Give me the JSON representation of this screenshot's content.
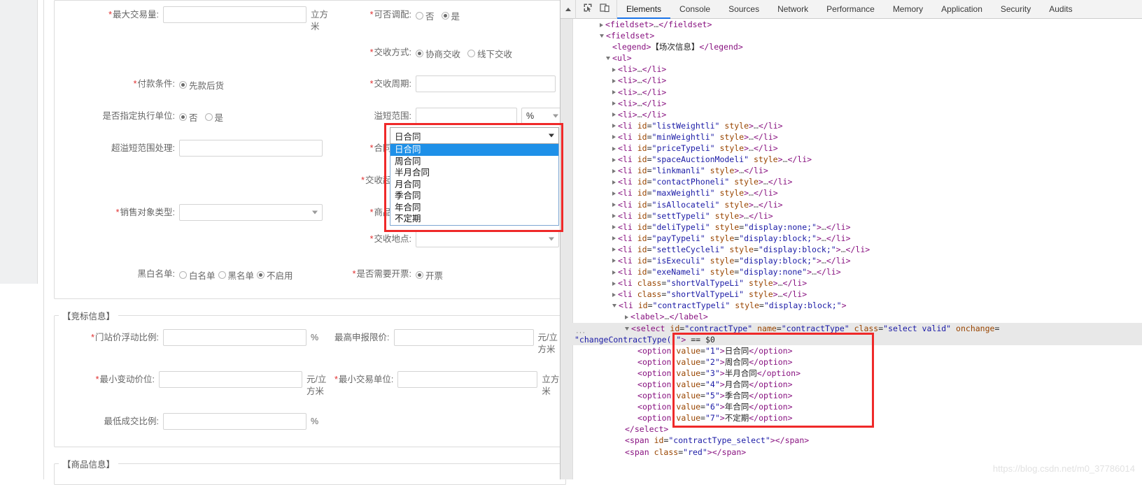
{
  "browser": {
    "section_auction": {
      "rows_left": [
        {
          "label": "最大交易量",
          "required": true,
          "type": "input",
          "value": "",
          "unit": "立方米"
        },
        {
          "label": "付款条件",
          "required": true,
          "type": "radio",
          "options": [
            {
              "text": "先款后货",
              "checked": true
            }
          ]
        },
        {
          "label": "是否指定执行单位",
          "required": false,
          "type": "radio",
          "options": [
            {
              "text": "否",
              "checked": true
            },
            {
              "text": "是",
              "checked": false
            }
          ]
        },
        {
          "label": "超溢短范围处理",
          "required": false,
          "type": "input",
          "value": "",
          "unit": ""
        },
        {
          "label": "销售对象类型",
          "required": true,
          "type": "select",
          "value": ""
        },
        {
          "label": "黑白名单",
          "required": false,
          "type": "radio",
          "options": [
            {
              "text": "白名单",
              "checked": false
            },
            {
              "text": "黑名单",
              "checked": false
            },
            {
              "text": "不启用",
              "checked": true
            }
          ]
        }
      ],
      "rows_right": [
        {
          "label": "可否调配",
          "required": true,
          "type": "radio",
          "options": [
            {
              "text": "否",
              "checked": false
            },
            {
              "text": "是",
              "checked": true
            }
          ]
        },
        {
          "label": "交收方式",
          "required": true,
          "type": "radio",
          "options": [
            {
              "text": "协商交收",
              "checked": true
            },
            {
              "text": "线下交收",
              "checked": false
            }
          ]
        },
        {
          "label": "交收周期",
          "required": true,
          "type": "input",
          "value": "",
          "unit": ""
        },
        {
          "label": "溢短范围",
          "required": false,
          "type": "input_select",
          "value": "",
          "select_value": "%"
        },
        {
          "label": "合同类型",
          "required": true,
          "type": "select_open",
          "value": "日合同"
        },
        {
          "label": "交收起始日",
          "required": true,
          "type": "input",
          "value": "",
          "unit": ""
        },
        {
          "label": "商品运输",
          "required": true,
          "type": "input",
          "value": "",
          "unit": ""
        },
        {
          "label": "交收地点",
          "required": true,
          "type": "select",
          "value": ""
        },
        {
          "label": "是否需要开票",
          "required": true,
          "type": "radio",
          "options": [
            {
              "text": "开票",
              "checked": true
            }
          ]
        }
      ]
    },
    "section_bid": {
      "legend": "【竞标信息】",
      "rows": [
        {
          "label": "门站价浮动比例",
          "required": true,
          "unit": "%",
          "label2": "最高申报限价",
          "required2": false,
          "unit2": "元/立方米"
        },
        {
          "label": "最小变动价位",
          "required": true,
          "unit": "元/立方米",
          "label2": "最小交易单位",
          "required2": true,
          "unit2": "立方米"
        },
        {
          "label": "最低成交比例",
          "required": false,
          "unit": "%",
          "label2": "",
          "required2": false,
          "unit2": ""
        }
      ]
    },
    "section_goods": {
      "legend": "【商品信息】"
    },
    "dropdown": {
      "selected": "日合同",
      "options": [
        "日合同",
        "周合同",
        "半月合同",
        "月合同",
        "季合同",
        "年合同",
        "不定期"
      ],
      "highlight_color": "#ef2929",
      "selected_bg": "#1e90e8"
    }
  },
  "devtools": {
    "toolbar": {
      "inspect_icon": "inspect-element-icon",
      "device_icon": "toggle-device-toolbar-icon",
      "scroll_up_icon": "scroll-up-arrow-icon"
    },
    "tabs": [
      {
        "label": "Elements",
        "active": true
      },
      {
        "label": "Console",
        "active": false
      },
      {
        "label": "Sources",
        "active": false
      },
      {
        "label": "Network",
        "active": false
      },
      {
        "label": "Performance",
        "active": false
      },
      {
        "label": "Memory",
        "active": false
      },
      {
        "label": "Application",
        "active": false
      },
      {
        "label": "Security",
        "active": false
      },
      {
        "label": "Audits",
        "active": false
      }
    ],
    "tree": [
      {
        "indent": 4,
        "tw": "closed",
        "html": "<span class=\"punc\">&lt;</span><span class=\"tag\">fieldset</span><span class=\"punc\">&gt;</span><span class=\"ell\">…</span><span class=\"punc\">&lt;/</span><span class=\"tag\">fieldset</span><span class=\"punc\">&gt;</span>"
      },
      {
        "indent": 4,
        "tw": "open",
        "html": "<span class=\"punc\">&lt;</span><span class=\"tag\">fieldset</span><span class=\"punc\">&gt;</span>"
      },
      {
        "indent": 6,
        "tw": "none",
        "html": "<span class=\"punc\">&lt;</span><span class=\"tag\">legend</span><span class=\"punc\">&gt;</span><span class=\"txtnode\">【场次信息】</span><span class=\"punc\">&lt;/</span><span class=\"tag\">legend</span><span class=\"punc\">&gt;</span>"
      },
      {
        "indent": 5,
        "tw": "open",
        "html": "<span class=\"punc\">&lt;</span><span class=\"tag\">ul</span><span class=\"punc\">&gt;</span>"
      },
      {
        "indent": 6,
        "tw": "closed",
        "html": "<span class=\"punc\">&lt;</span><span class=\"tag\">li</span><span class=\"punc\">&gt;</span><span class=\"ell\">…</span><span class=\"punc\">&lt;/</span><span class=\"tag\">li</span><span class=\"punc\">&gt;</span>"
      },
      {
        "indent": 6,
        "tw": "closed",
        "html": "<span class=\"punc\">&lt;</span><span class=\"tag\">li</span><span class=\"punc\">&gt;</span><span class=\"ell\">…</span><span class=\"punc\">&lt;/</span><span class=\"tag\">li</span><span class=\"punc\">&gt;</span>"
      },
      {
        "indent": 6,
        "tw": "closed",
        "html": "<span class=\"punc\">&lt;</span><span class=\"tag\">li</span><span class=\"punc\">&gt;</span><span class=\"ell\">…</span><span class=\"punc\">&lt;/</span><span class=\"tag\">li</span><span class=\"punc\">&gt;</span>"
      },
      {
        "indent": 6,
        "tw": "closed",
        "html": "<span class=\"punc\">&lt;</span><span class=\"tag\">li</span><span class=\"punc\">&gt;</span><span class=\"ell\">…</span><span class=\"punc\">&lt;/</span><span class=\"tag\">li</span><span class=\"punc\">&gt;</span>"
      },
      {
        "indent": 6,
        "tw": "closed",
        "html": "<span class=\"punc\">&lt;</span><span class=\"tag\">li</span><span class=\"punc\">&gt;</span><span class=\"ell\">…</span><span class=\"punc\">&lt;/</span><span class=\"tag\">li</span><span class=\"punc\">&gt;</span>"
      },
      {
        "indent": 6,
        "tw": "closed",
        "html": "<span class=\"punc\">&lt;</span><span class=\"tag\">li</span> <span class=\"attr\">id</span>=<span class=\"val\">\"listWeightli\"</span> <span class=\"attr\">style</span><span class=\"punc\">&gt;</span><span class=\"ell\">…</span><span class=\"punc\">&lt;/</span><span class=\"tag\">li</span><span class=\"punc\">&gt;</span>"
      },
      {
        "indent": 6,
        "tw": "closed",
        "html": "<span class=\"punc\">&lt;</span><span class=\"tag\">li</span> <span class=\"attr\">id</span>=<span class=\"val\">\"minWeightli\"</span> <span class=\"attr\">style</span><span class=\"punc\">&gt;</span><span class=\"ell\">…</span><span class=\"punc\">&lt;/</span><span class=\"tag\">li</span><span class=\"punc\">&gt;</span>"
      },
      {
        "indent": 6,
        "tw": "closed",
        "html": "<span class=\"punc\">&lt;</span><span class=\"tag\">li</span> <span class=\"attr\">id</span>=<span class=\"val\">\"priceTypeli\"</span> <span class=\"attr\">style</span><span class=\"punc\">&gt;</span><span class=\"ell\">…</span><span class=\"punc\">&lt;/</span><span class=\"tag\">li</span><span class=\"punc\">&gt;</span>"
      },
      {
        "indent": 6,
        "tw": "closed",
        "html": "<span class=\"punc\">&lt;</span><span class=\"tag\">li</span> <span class=\"attr\">id</span>=<span class=\"val\">\"spaceAuctionModeli\"</span> <span class=\"attr\">style</span><span class=\"punc\">&gt;</span><span class=\"ell\">…</span><span class=\"punc\">&lt;/</span><span class=\"tag\">li</span><span class=\"punc\">&gt;</span>"
      },
      {
        "indent": 6,
        "tw": "closed",
        "html": "<span class=\"punc\">&lt;</span><span class=\"tag\">li</span> <span class=\"attr\">id</span>=<span class=\"val\">\"linkmanli\"</span> <span class=\"attr\">style</span><span class=\"punc\">&gt;</span><span class=\"ell\">…</span><span class=\"punc\">&lt;/</span><span class=\"tag\">li</span><span class=\"punc\">&gt;</span>"
      },
      {
        "indent": 6,
        "tw": "closed",
        "html": "<span class=\"punc\">&lt;</span><span class=\"tag\">li</span> <span class=\"attr\">id</span>=<span class=\"val\">\"contactPhoneli\"</span> <span class=\"attr\">style</span><span class=\"punc\">&gt;</span><span class=\"ell\">…</span><span class=\"punc\">&lt;/</span><span class=\"tag\">li</span><span class=\"punc\">&gt;</span>"
      },
      {
        "indent": 6,
        "tw": "closed",
        "html": "<span class=\"punc\">&lt;</span><span class=\"tag\">li</span> <span class=\"attr\">id</span>=<span class=\"val\">\"maxWeightli\"</span> <span class=\"attr\">style</span><span class=\"punc\">&gt;</span><span class=\"ell\">…</span><span class=\"punc\">&lt;/</span><span class=\"tag\">li</span><span class=\"punc\">&gt;</span>"
      },
      {
        "indent": 6,
        "tw": "closed",
        "html": "<span class=\"punc\">&lt;</span><span class=\"tag\">li</span> <span class=\"attr\">id</span>=<span class=\"val\">\"isAllocateli\"</span> <span class=\"attr\">style</span><span class=\"punc\">&gt;</span><span class=\"ell\">…</span><span class=\"punc\">&lt;/</span><span class=\"tag\">li</span><span class=\"punc\">&gt;</span>"
      },
      {
        "indent": 6,
        "tw": "closed",
        "html": "<span class=\"punc\">&lt;</span><span class=\"tag\">li</span> <span class=\"attr\">id</span>=<span class=\"val\">\"settTypeli\"</span> <span class=\"attr\">style</span><span class=\"punc\">&gt;</span><span class=\"ell\">…</span><span class=\"punc\">&lt;/</span><span class=\"tag\">li</span><span class=\"punc\">&gt;</span>"
      },
      {
        "indent": 6,
        "tw": "closed",
        "html": "<span class=\"punc\">&lt;</span><span class=\"tag\">li</span> <span class=\"attr\">id</span>=<span class=\"val\">\"deliTypeli\"</span> <span class=\"attr\">style</span>=<span class=\"val\">\"display:none;\"</span><span class=\"punc\">&gt;</span><span class=\"ell\">…</span><span class=\"punc\">&lt;/</span><span class=\"tag\">li</span><span class=\"punc\">&gt;</span>"
      },
      {
        "indent": 6,
        "tw": "closed",
        "html": "<span class=\"punc\">&lt;</span><span class=\"tag\">li</span> <span class=\"attr\">id</span>=<span class=\"val\">\"payTypeli\"</span> <span class=\"attr\">style</span>=<span class=\"val\">\"display:block;\"</span><span class=\"punc\">&gt;</span><span class=\"ell\">…</span><span class=\"punc\">&lt;/</span><span class=\"tag\">li</span><span class=\"punc\">&gt;</span>"
      },
      {
        "indent": 6,
        "tw": "closed",
        "html": "<span class=\"punc\">&lt;</span><span class=\"tag\">li</span> <span class=\"attr\">id</span>=<span class=\"val\">\"settleCycleli\"</span> <span class=\"attr\">style</span>=<span class=\"val\">\"display:block;\"</span><span class=\"punc\">&gt;</span><span class=\"ell\">…</span><span class=\"punc\">&lt;/</span><span class=\"tag\">li</span><span class=\"punc\">&gt;</span>"
      },
      {
        "indent": 6,
        "tw": "closed",
        "html": "<span class=\"punc\">&lt;</span><span class=\"tag\">li</span> <span class=\"attr\">id</span>=<span class=\"val\">\"isExeculi\"</span> <span class=\"attr\">style</span>=<span class=\"val\">\"display:block;\"</span><span class=\"punc\">&gt;</span><span class=\"ell\">…</span><span class=\"punc\">&lt;/</span><span class=\"tag\">li</span><span class=\"punc\">&gt;</span>"
      },
      {
        "indent": 6,
        "tw": "closed",
        "html": "<span class=\"punc\">&lt;</span><span class=\"tag\">li</span> <span class=\"attr\">id</span>=<span class=\"val\">\"exeNameli\"</span> <span class=\"attr\">style</span>=<span class=\"val\">\"display:none\"</span><span class=\"punc\">&gt;</span><span class=\"ell\">…</span><span class=\"punc\">&lt;/</span><span class=\"tag\">li</span><span class=\"punc\">&gt;</span>"
      },
      {
        "indent": 6,
        "tw": "closed",
        "html": "<span class=\"punc\">&lt;</span><span class=\"tag\">li</span> <span class=\"attr\">class</span>=<span class=\"val\">\"shortValTypeLi\"</span> <span class=\"attr\">style</span><span class=\"punc\">&gt;</span><span class=\"ell\">…</span><span class=\"punc\">&lt;/</span><span class=\"tag\">li</span><span class=\"punc\">&gt;</span>"
      },
      {
        "indent": 6,
        "tw": "closed",
        "html": "<span class=\"punc\">&lt;</span><span class=\"tag\">li</span> <span class=\"attr\">class</span>=<span class=\"val\">\"shortValTypeLi\"</span> <span class=\"attr\">style</span><span class=\"punc\">&gt;</span><span class=\"ell\">…</span><span class=\"punc\">&lt;/</span><span class=\"tag\">li</span><span class=\"punc\">&gt;</span>"
      },
      {
        "indent": 6,
        "tw": "open",
        "html": "<span class=\"punc\">&lt;</span><span class=\"tag\">li</span> <span class=\"attr\">id</span>=<span class=\"val\">\"contractTypeli\"</span> <span class=\"attr\">style</span>=<span class=\"val\">\"display:block;\"</span><span class=\"punc\">&gt;</span>"
      },
      {
        "indent": 8,
        "tw": "closed",
        "html": "<span class=\"punc\">&lt;</span><span class=\"tag\">label</span><span class=\"punc\">&gt;</span><span class=\"ell\">…</span><span class=\"punc\">&lt;/</span><span class=\"tag\">label</span><span class=\"punc\">&gt;</span>"
      },
      {
        "indent": 8,
        "tw": "open",
        "hl": true,
        "html": "<span class=\"punc\">&lt;</span><span class=\"tag\">select</span> <span class=\"attr\">id</span>=<span class=\"val\">\"contractType\"</span> <span class=\"attr\">name</span>=<span class=\"val\">\"contractType\"</span> <span class=\"attr\">class</span>=<span class=\"val\">\"select valid\"</span> <span class=\"attr\">onchange</span>="
      },
      {
        "indent": 0,
        "tw": "none",
        "hl": true,
        "html": "<span class=\"val\">\"changeContractType()\"</span><span class=\"punc\">&gt;</span> <span class=\"dollar\">== $0</span>"
      },
      {
        "indent": 10,
        "tw": "none",
        "html": "<span class=\"punc\">&lt;</span><span class=\"tag\">option</span> <span class=\"attr\">value</span>=<span class=\"val\">\"1\"</span><span class=\"punc\">&gt;</span><span class=\"txtnode\">日合同</span><span class=\"punc\">&lt;/</span><span class=\"tag\">option</span><span class=\"punc\">&gt;</span>"
      },
      {
        "indent": 10,
        "tw": "none",
        "html": "<span class=\"punc\">&lt;</span><span class=\"tag\">option</span> <span class=\"attr\">value</span>=<span class=\"val\">\"2\"</span><span class=\"punc\">&gt;</span><span class=\"txtnode\">周合同</span><span class=\"punc\">&lt;/</span><span class=\"tag\">option</span><span class=\"punc\">&gt;</span>"
      },
      {
        "indent": 10,
        "tw": "none",
        "html": "<span class=\"punc\">&lt;</span><span class=\"tag\">option</span> <span class=\"attr\">value</span>=<span class=\"val\">\"3\"</span><span class=\"punc\">&gt;</span><span class=\"txtnode\">半月合同</span><span class=\"punc\">&lt;/</span><span class=\"tag\">option</span><span class=\"punc\">&gt;</span>"
      },
      {
        "indent": 10,
        "tw": "none",
        "html": "<span class=\"punc\">&lt;</span><span class=\"tag\">option</span> <span class=\"attr\">value</span>=<span class=\"val\">\"4\"</span><span class=\"punc\">&gt;</span><span class=\"txtnode\">月合同</span><span class=\"punc\">&lt;/</span><span class=\"tag\">option</span><span class=\"punc\">&gt;</span>"
      },
      {
        "indent": 10,
        "tw": "none",
        "html": "<span class=\"punc\">&lt;</span><span class=\"tag\">option</span> <span class=\"attr\">value</span>=<span class=\"val\">\"5\"</span><span class=\"punc\">&gt;</span><span class=\"txtnode\">季合同</span><span class=\"punc\">&lt;/</span><span class=\"tag\">option</span><span class=\"punc\">&gt;</span>"
      },
      {
        "indent": 10,
        "tw": "none",
        "html": "<span class=\"punc\">&lt;</span><span class=\"tag\">option</span> <span class=\"attr\">value</span>=<span class=\"val\">\"6\"</span><span class=\"punc\">&gt;</span><span class=\"txtnode\">年合同</span><span class=\"punc\">&lt;/</span><span class=\"tag\">option</span><span class=\"punc\">&gt;</span>"
      },
      {
        "indent": 10,
        "tw": "none",
        "html": "<span class=\"punc\">&lt;</span><span class=\"tag\">option</span> <span class=\"attr\">value</span>=<span class=\"val\">\"7\"</span><span class=\"punc\">&gt;</span><span class=\"txtnode\">不定期</span><span class=\"punc\">&lt;/</span><span class=\"tag\">option</span><span class=\"punc\">&gt;</span>"
      },
      {
        "indent": 8,
        "tw": "none",
        "html": "<span class=\"punc\">&lt;/</span><span class=\"tag\">select</span><span class=\"punc\">&gt;</span>"
      },
      {
        "indent": 8,
        "tw": "none",
        "html": "<span class=\"punc\">&lt;</span><span class=\"tag\">span</span> <span class=\"attr\">id</span>=<span class=\"val\">\"contractType_select\"</span><span class=\"punc\">&gt;&lt;/</span><span class=\"tag\">span</span><span class=\"punc\">&gt;</span>"
      },
      {
        "indent": 8,
        "tw": "none",
        "html": "<span class=\"punc\">&lt;</span><span class=\"tag\">span</span> <span class=\"attr\">class</span>=<span class=\"val\">\"red\"</span><span class=\"punc\">&gt;&lt;/</span><span class=\"tag\">span</span><span class=\"punc\">&gt;</span>"
      }
    ],
    "dots_badge": "···",
    "highlight_color": "#ef2929"
  },
  "watermark": "https://blog.csdn.net/m0_37786014"
}
